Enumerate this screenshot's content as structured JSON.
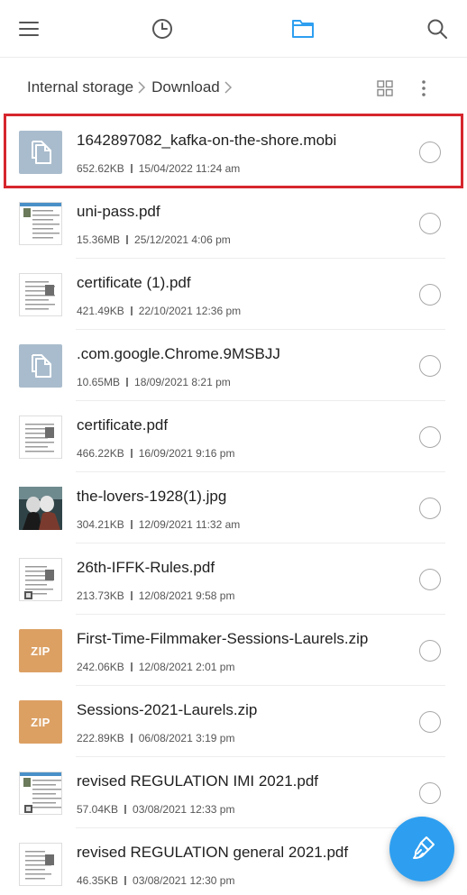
{
  "topbar": {
    "icons": [
      "menu-icon",
      "recent-clock-icon",
      "folder-icon",
      "search-icon"
    ],
    "accent": "#2e9ff0"
  },
  "breadcrumb": {
    "items": [
      "Internal storage",
      "Download"
    ]
  },
  "files": [
    {
      "name": "1642897082_kafka-on-the-shore.mobi",
      "size": "652.62KB",
      "date": "15/04/2022 11:24 am",
      "thumb": "document-icon"
    },
    {
      "name": "uni-pass.pdf",
      "size": "15.36MB",
      "date": "25/12/2021 4:06 pm",
      "thumb": "pdf-thumbnail"
    },
    {
      "name": "certificate (1).pdf",
      "size": "421.49KB",
      "date": "22/10/2021 12:36 pm",
      "thumb": "pdf-thumbnail"
    },
    {
      "name": ".com.google.Chrome.9MSBJJ",
      "size": "10.65MB",
      "date": "18/09/2021 8:21 pm",
      "thumb": "document-icon"
    },
    {
      "name": "certificate.pdf",
      "size": "466.22KB",
      "date": "16/09/2021 9:16 pm",
      "thumb": "pdf-thumbnail"
    },
    {
      "name": "the-lovers-1928(1).jpg",
      "size": "304.21KB",
      "date": "12/09/2021 11:32 am",
      "thumb": "image-thumbnail"
    },
    {
      "name": "26th-IFFK-Rules.pdf",
      "size": "213.73KB",
      "date": "12/08/2021 9:58 pm",
      "thumb": "pdf-thumbnail"
    },
    {
      "name": "First-Time-Filmmaker-Sessions-Laurels.zip",
      "size": "242.06KB",
      "date": "12/08/2021 2:01 pm",
      "thumb": "zip-icon",
      "badge": "ZIP"
    },
    {
      "name": "Sessions-2021-Laurels.zip",
      "size": "222.89KB",
      "date": "06/08/2021 3:19 pm",
      "thumb": "zip-icon",
      "badge": "ZIP"
    },
    {
      "name": "revised REGULATION IMI 2021.pdf",
      "size": "57.04KB",
      "date": "03/08/2021 12:33 pm",
      "thumb": "pdf-thumbnail"
    },
    {
      "name": "revised REGULATION general 2021.pdf",
      "size": "46.35KB",
      "date": "03/08/2021 12:30 pm",
      "thumb": "pdf-thumbnail"
    }
  ],
  "selected_index": 0,
  "colors": {
    "highlight": "#d6262e",
    "doc_thumb": "#a9bccd",
    "zip_thumb": "#dca063",
    "fab": "#2e9ff0"
  },
  "fab": {
    "icon": "broom-clean-icon"
  }
}
